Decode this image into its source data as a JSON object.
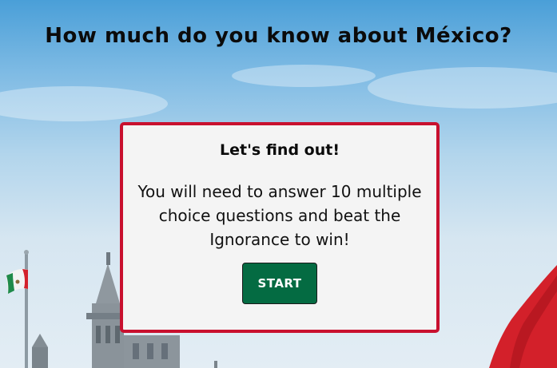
{
  "header": {
    "title": "How much do you know about México?"
  },
  "card": {
    "heading": "Let's find out!",
    "description": "You will need to answer 10 multiple choice questions and beat the Ignorance to win!",
    "start_label": "START"
  },
  "colors": {
    "card_border": "#c8102e",
    "card_background": "#f4f4f4",
    "start_button": "#046b42",
    "sky_top": "#4a9fd8",
    "sky_bottom": "#e3edf4",
    "flag_green": "#1f8a4a",
    "flag_red": "#d3202a"
  },
  "icons": {
    "flagpole_flag": "mexican-flag-icon",
    "building": "palace-building-icon",
    "waving_flag": "waving-flag-icon"
  }
}
